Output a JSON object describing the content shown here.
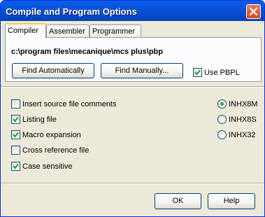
{
  "window": {
    "title": "Compile and Program Options"
  },
  "tabs": [
    {
      "label": "Compiler",
      "active": true
    },
    {
      "label": "Assembler",
      "active": false
    },
    {
      "label": "Programmer",
      "active": false
    }
  ],
  "compiler": {
    "path": "c:\\program files\\mecanique\\mcs plus\\pbp",
    "find_automatically_label": "Find Automatically",
    "find_manually_label": "Find Manually...",
    "use_pbpl": {
      "label": "Use PBPL",
      "checked": true
    }
  },
  "options": [
    {
      "label": "Insert source file comments",
      "checked": false
    },
    {
      "label": "Listing file",
      "checked": true
    },
    {
      "label": "Macro expansion",
      "checked": true
    },
    {
      "label": "Cross reference file",
      "checked": false
    },
    {
      "label": "Case sensitive",
      "checked": true
    }
  ],
  "hex_format": [
    {
      "label": "INHX8M",
      "selected": true
    },
    {
      "label": "INHX8S",
      "selected": false
    },
    {
      "label": "INHX32",
      "selected": false
    }
  ],
  "buttons": {
    "ok_label": "OK",
    "help_label": "Help"
  }
}
